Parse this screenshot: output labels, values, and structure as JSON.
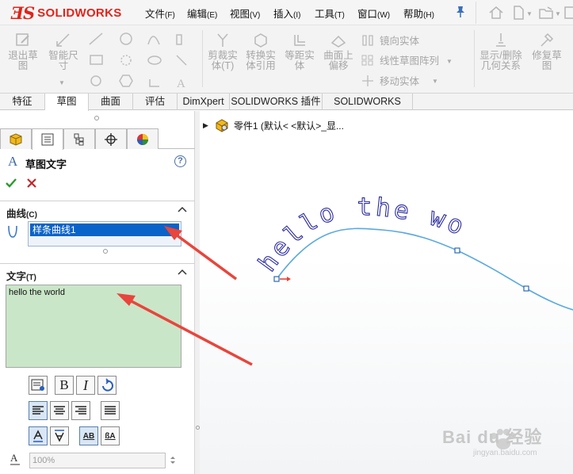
{
  "app": {
    "logo_text": "SOLIDWORKS"
  },
  "menu": [
    {
      "label": "文件",
      "hotkey": "(F)"
    },
    {
      "label": "编辑",
      "hotkey": "(E)"
    },
    {
      "label": "视图",
      "hotkey": "(V)"
    },
    {
      "label": "插入",
      "hotkey": "(I)"
    },
    {
      "label": "工具",
      "hotkey": "(T)"
    },
    {
      "label": "窗口",
      "hotkey": "(W)"
    },
    {
      "label": "帮助",
      "hotkey": "(H)"
    }
  ],
  "ribbon": {
    "exit_sketch": "退出草\n图",
    "smart_dimension": "智能尺\n寸",
    "trim": "剪裁实\n体(T)",
    "convert": "转换实\n体引用",
    "offset": "等距实\n体",
    "surface_offset": "曲面上\n偏移",
    "mirror": "镜向实体",
    "linear_pattern": "线性草图阵列",
    "move": "移动实体",
    "show_relations": "显示/删除\n几何关系",
    "repair": "修复草\n图"
  },
  "tabs": [
    "特征",
    "草图",
    "曲面",
    "评估",
    "DimXpert",
    "SOLIDWORKS 插件",
    "SOLIDWORKS MBD"
  ],
  "active_tab": "草图",
  "property_manager": {
    "title": "草图文字",
    "curves_group": {
      "label": "曲线",
      "hotkey": "(C)",
      "selected_item": "样条曲线1"
    },
    "text_group": {
      "label": "文字",
      "hotkey": "(T)",
      "text": "hello the world"
    },
    "width_factor": "100%"
  },
  "feature_tree": {
    "root_label": "零件1  (默认< <默认>_显..."
  },
  "canvas": {
    "sketch_text": "hello the world",
    "curve_color": "#5aa9e0",
    "text_color": "#2b2b9e",
    "arrow_color": "#e8413a"
  },
  "watermark": {
    "brand": "Bai du 经验",
    "url": "jingyan.baidu.com"
  }
}
